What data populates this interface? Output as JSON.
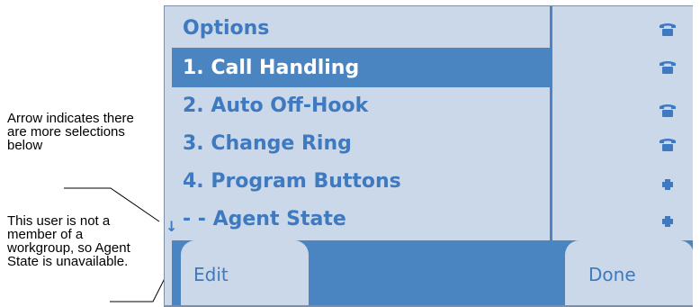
{
  "annotations": {
    "arrow_note": "Arrow indicates there are more selections below",
    "workgroup_note": "This user is not a member of a workgroup, so Agent State is unavailable."
  },
  "screen": {
    "title": "Options",
    "selected_index": 0,
    "more_below_indicator": "↓",
    "items": [
      {
        "label": "1. Call Handling",
        "icon": "phone-icon"
      },
      {
        "label": "2. Auto Off-Hook",
        "icon": "phone-icon"
      },
      {
        "label": "3. Change Ring",
        "icon": "phone-icon"
      },
      {
        "label": "4. Program Buttons",
        "icon": "button-key-icon"
      },
      {
        "label": "- - Agent State",
        "icon": "button-key-icon"
      }
    ],
    "header_icon": "phone-icon",
    "softkeys": {
      "left": "Edit",
      "right": "Done"
    }
  },
  "colors": {
    "screen_background": "#cbd8e9",
    "accent_blue": "#4a84c1",
    "text_blue": "#3f79bf"
  }
}
